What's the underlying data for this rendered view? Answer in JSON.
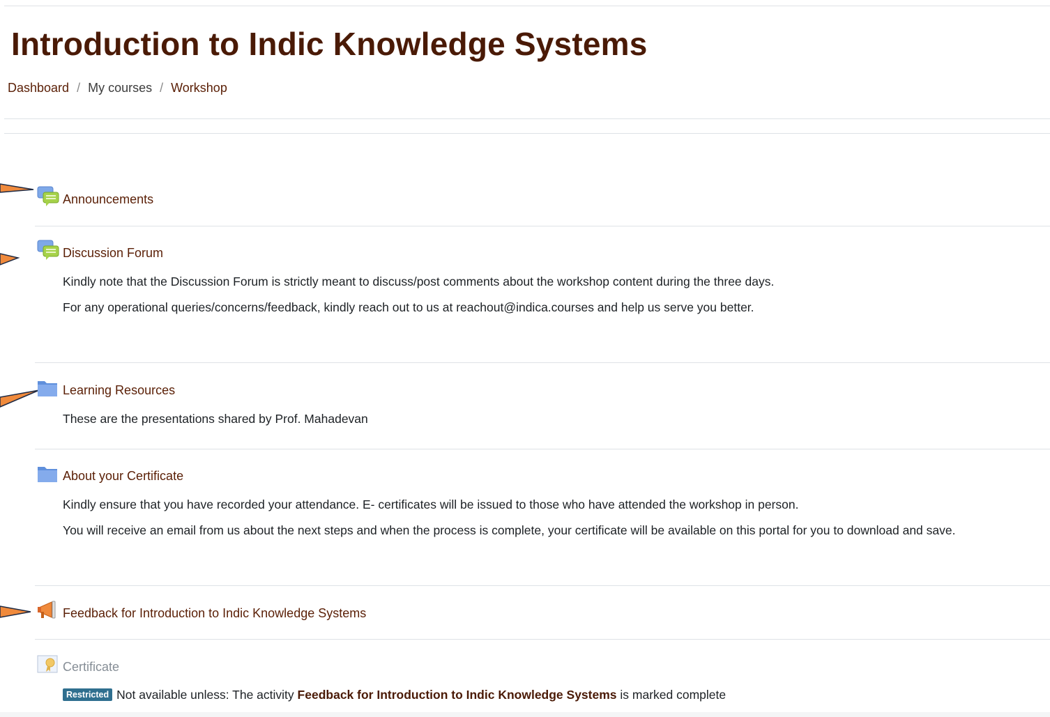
{
  "page": {
    "title": "Introduction to Indic Knowledge Systems"
  },
  "breadcrumb": {
    "items": [
      "Dashboard",
      "My courses",
      "Workshop"
    ],
    "separator": "/"
  },
  "activities": [
    {
      "title": "Announcements",
      "icon": "forum-icon",
      "description": []
    },
    {
      "title": "Discussion Forum",
      "icon": "forum-icon",
      "description": [
        "Kindly note that the Discussion Forum is strictly meant to discuss/post comments about the workshop content during the three days.",
        "For any operational queries/concerns/feedback, kindly reach out to us at reachout@indica.courses and help us serve you better."
      ]
    },
    {
      "title": "Learning Resources",
      "icon": "folder-icon",
      "description": [
        "These are the presentations shared by Prof. Mahadevan"
      ]
    },
    {
      "title": "About your Certificate",
      "icon": "folder-icon",
      "description": [
        "Kindly ensure that you have recorded your attendance. E- certificates will be issued to those who have attended the workshop in person.",
        "You will receive an email from us about the next steps and when the process is complete, your certificate will be available on this portal for you to download and save."
      ]
    },
    {
      "title": "Feedback for Introduction to Indic Knowledge Systems",
      "icon": "megaphone-icon",
      "description": []
    },
    {
      "title": "Certificate",
      "icon": "certificate-icon",
      "description": []
    }
  ],
  "restriction": {
    "badge": "Restricted",
    "prefix": "Not available unless: The activity",
    "activity": "Feedback for Introduction to Indic Knowledge Systems",
    "suffix": "is marked complete"
  },
  "colors": {
    "title": "#4a1a06",
    "link": "#5a1f06",
    "annotation_arrow": "#f08a3c",
    "badge": "#2f6f8f"
  }
}
